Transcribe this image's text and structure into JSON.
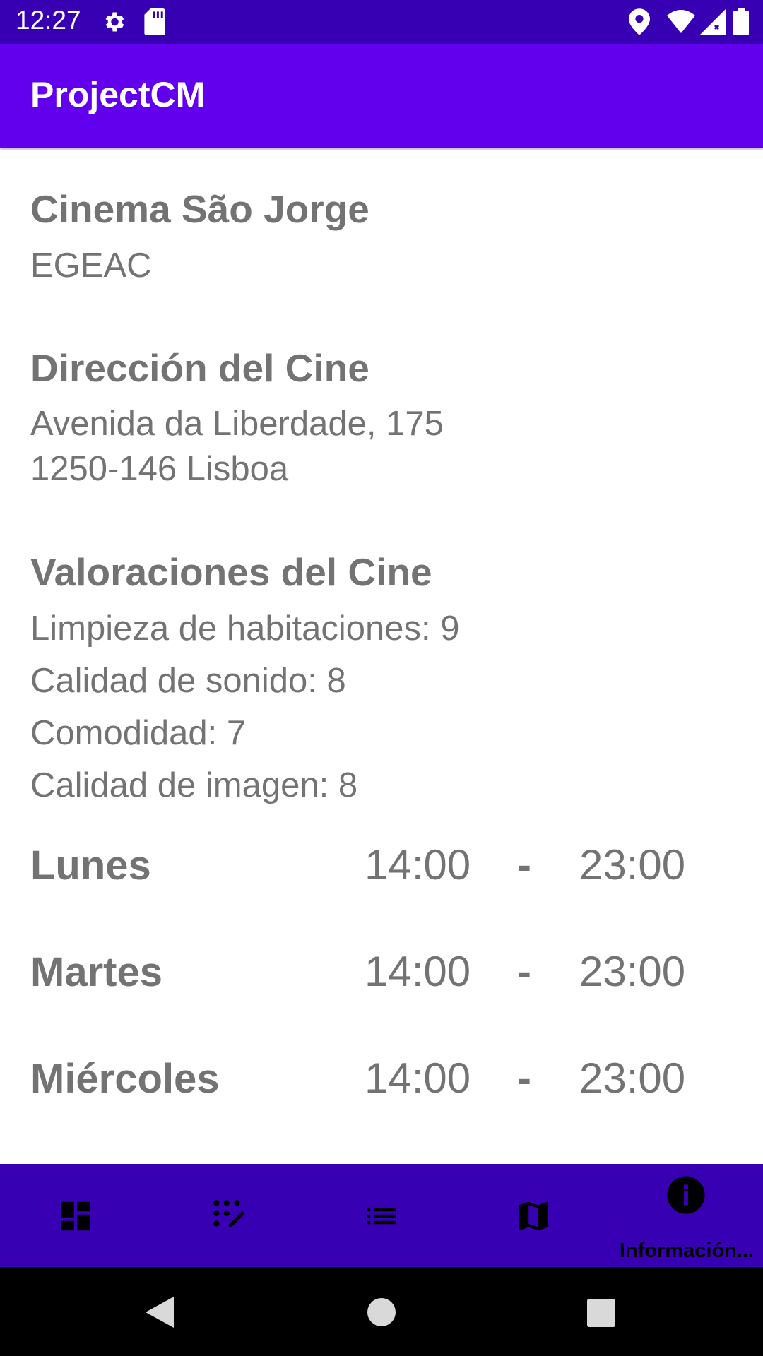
{
  "status_bar": {
    "time": "12:27",
    "icons": [
      "gear-icon",
      "sd-card-icon",
      "location-icon",
      "wifi-icon",
      "signal-icon",
      "battery-icon"
    ]
  },
  "app_bar": {
    "title": "ProjectCM"
  },
  "cinema": {
    "name": "Cinema São Jorge",
    "operator": "EGEAC"
  },
  "address": {
    "heading": "Dirección del Cine",
    "line1": "Avenida da Liberdade, 175",
    "line2": "1250-146 Lisboa"
  },
  "ratings": {
    "heading": "Valoraciones del Cine",
    "items": [
      {
        "label": "Limpieza de habitaciones:  9"
      },
      {
        "label": "Calidad de sonido:  8"
      },
      {
        "label": "Comodidad:  7"
      },
      {
        "label": "Calidad de imagen:  8"
      }
    ]
  },
  "schedule": [
    {
      "day": "Lunes",
      "open": "14:00",
      "sep": "-",
      "close": "23:00"
    },
    {
      "day": "Martes",
      "open": "14:00",
      "sep": "-",
      "close": "23:00"
    },
    {
      "day": "Miércoles",
      "open": "14:00",
      "sep": "-",
      "close": "23:00"
    }
  ],
  "bottom_nav": {
    "items": [
      {
        "icon": "dashboard-icon"
      },
      {
        "icon": "dialpad-edit-icon"
      },
      {
        "icon": "list-icon"
      },
      {
        "icon": "map-icon"
      },
      {
        "icon": "info-icon",
        "label": "Información..."
      }
    ],
    "selected_index": 4
  },
  "system_nav": {
    "icons": [
      "back-icon",
      "home-icon",
      "recents-icon"
    ]
  },
  "colors": {
    "status_bar": "#3700b3",
    "app_bar": "#6200ee",
    "bottom_nav": "#3700b3",
    "text": "#737373"
  }
}
